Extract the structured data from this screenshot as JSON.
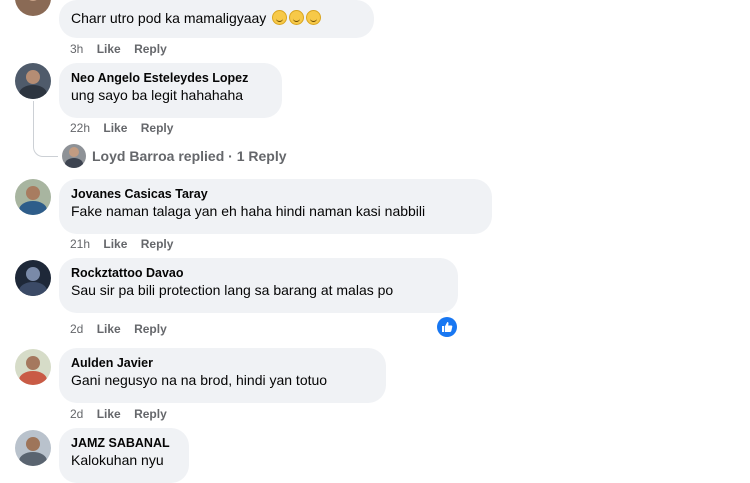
{
  "comments": [
    {
      "author": "",
      "text": "Charr utro pod ka mamaligyaay",
      "time": "3h",
      "like": "Like",
      "reply": "Reply",
      "emoji_icons": [
        "grinning-sweat-emoji",
        "grinning-sweat-emoji",
        "grinning-sweat-emoji"
      ]
    },
    {
      "author": "Neo Angelo Esteleydes Lopez",
      "text": "ung sayo ba legit hahahaha",
      "time": "22h",
      "like": "Like",
      "reply": "Reply",
      "replies_summary": "Loyd Barroa replied · 1 Reply"
    },
    {
      "author": "Jovanes Casicas Taray",
      "text": "Fake naman talaga yan eh haha hindi naman kasi nabbili",
      "time": "21h",
      "like": "Like",
      "reply": "Reply"
    },
    {
      "author": "Rockztattoo Davao",
      "text": "Sau sir pa bili protection lang sa barang at malas po",
      "time": "2d",
      "like": "Like",
      "reply": "Reply",
      "reaction_icon": "like-reaction-icon"
    },
    {
      "author": "Aulden Javier",
      "text": "Gani negusyo na na brod, hindi yan totuo",
      "time": "2d",
      "like": "Like",
      "reply": "Reply"
    },
    {
      "author": "JAMZ SABANAL",
      "text": "Kalokuhan nyu"
    }
  ],
  "colors": {
    "bubble_bg": "#f0f2f5",
    "meta_text": "#65676b",
    "like_blue": "#1877f2"
  }
}
